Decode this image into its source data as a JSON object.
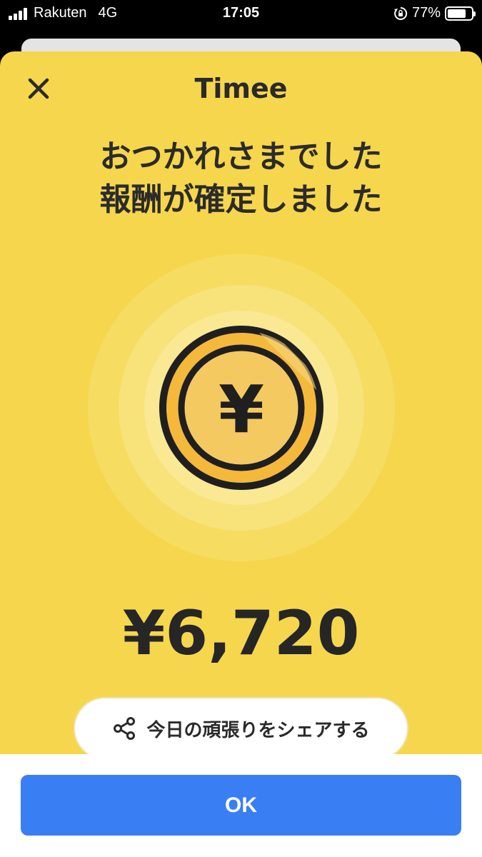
{
  "status_bar": {
    "carrier": "Rakuten",
    "network": "4G",
    "time": "17:05",
    "battery_percent_label": "77%",
    "battery_level": 0.77,
    "icons": [
      "signal-icon",
      "orientation-lock-icon",
      "battery-icon"
    ]
  },
  "modal": {
    "brand": "Timee",
    "close_icon": "close-icon",
    "headline_line1": "おつかれさまでした",
    "headline_line2": "報酬が確定しました",
    "coin_icon": "yen-coin-icon",
    "coin_symbol": "¥",
    "amount": "¥6,720",
    "share_label": "今日の頑張りをシェアする",
    "share_icon": "share-icon"
  },
  "footer": {
    "ok_label": "OK"
  },
  "colors": {
    "modal_background": "#f6d64d",
    "coin_gold": "#f4b93a",
    "ok_button": "#3a7ef4",
    "text_dark": "#2b2b2b"
  }
}
